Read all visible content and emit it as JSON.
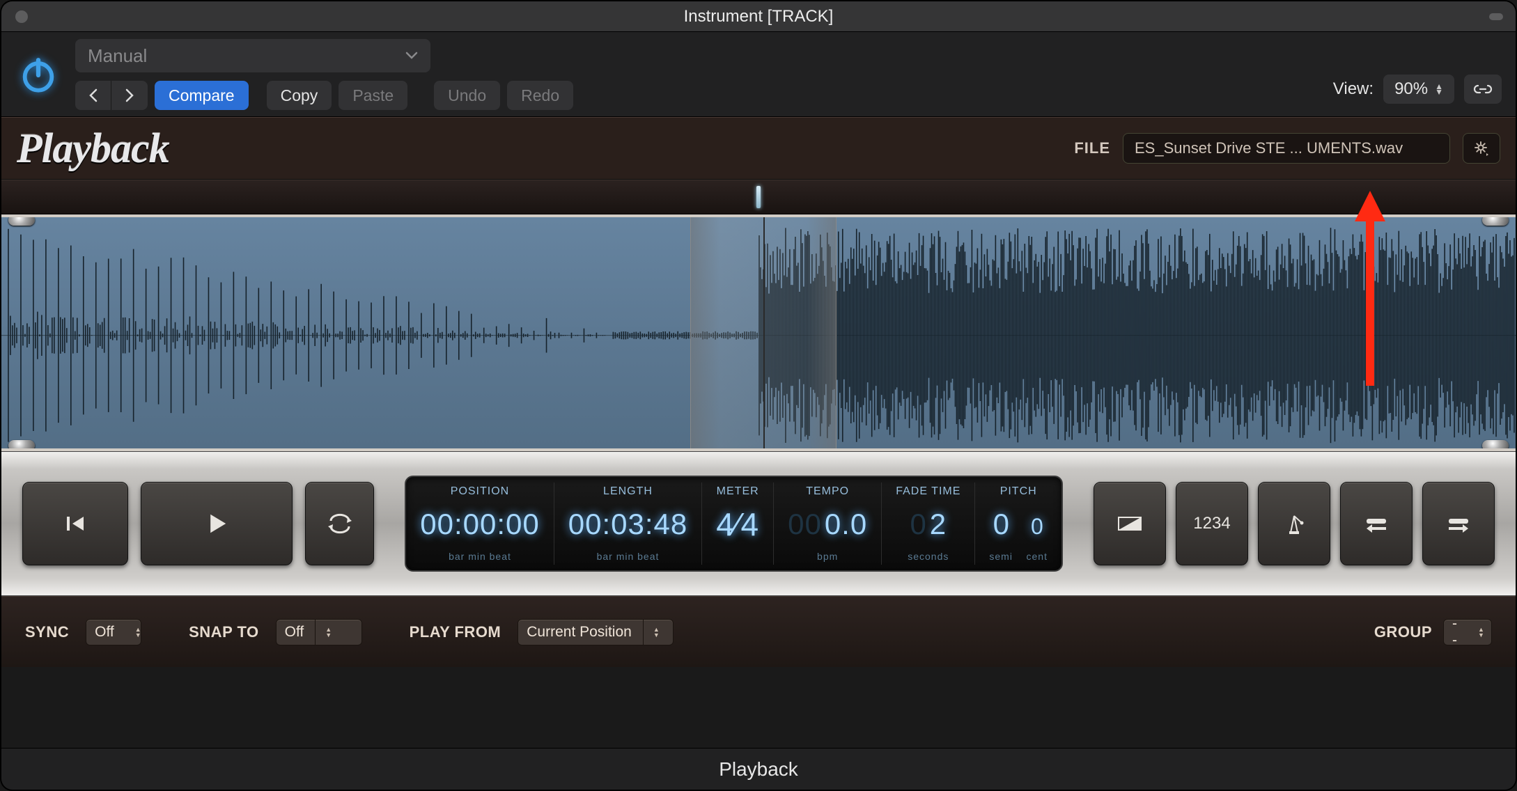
{
  "window": {
    "title": "Instrument [TRACK]"
  },
  "toolbar": {
    "preset": "Manual",
    "compare": "Compare",
    "copy": "Copy",
    "paste": "Paste",
    "undo": "Undo",
    "redo": "Redo",
    "view_label": "View:",
    "zoom": "90%"
  },
  "plugin": {
    "logo": "Playback",
    "file_label": "FILE",
    "file_name": "ES_Sunset Drive STE ... UMENTS.wav"
  },
  "lcd": {
    "position": {
      "title": "POSITION",
      "value": "00:00:00",
      "sub": "bar   min   beat"
    },
    "length": {
      "title": "LENGTH",
      "value": "00:03:48",
      "sub": "bar   min   beat"
    },
    "meter": {
      "title": "METER",
      "value": "4⁄4"
    },
    "tempo": {
      "title": "TEMPO",
      "value": "0.0",
      "prefix_dim": "00",
      "sub": "bpm"
    },
    "fade": {
      "title": "FADE TIME",
      "value": "2",
      "prefix_dim": "0",
      "sub": "seconds"
    },
    "pitch": {
      "title": "PITCH",
      "semi": "0",
      "cent": "0",
      "sub_semi": "semi",
      "sub_cent": "cent"
    }
  },
  "bottom": {
    "sync_label": "SYNC",
    "sync_value": "Off",
    "snap_label": "SNAP TO",
    "snap_value": "Off",
    "playfrom_label": "PLAY FROM",
    "playfrom_value": "Current Position",
    "group_label": "GROUP",
    "group_value": "--"
  },
  "footer": {
    "name": "Playback"
  }
}
